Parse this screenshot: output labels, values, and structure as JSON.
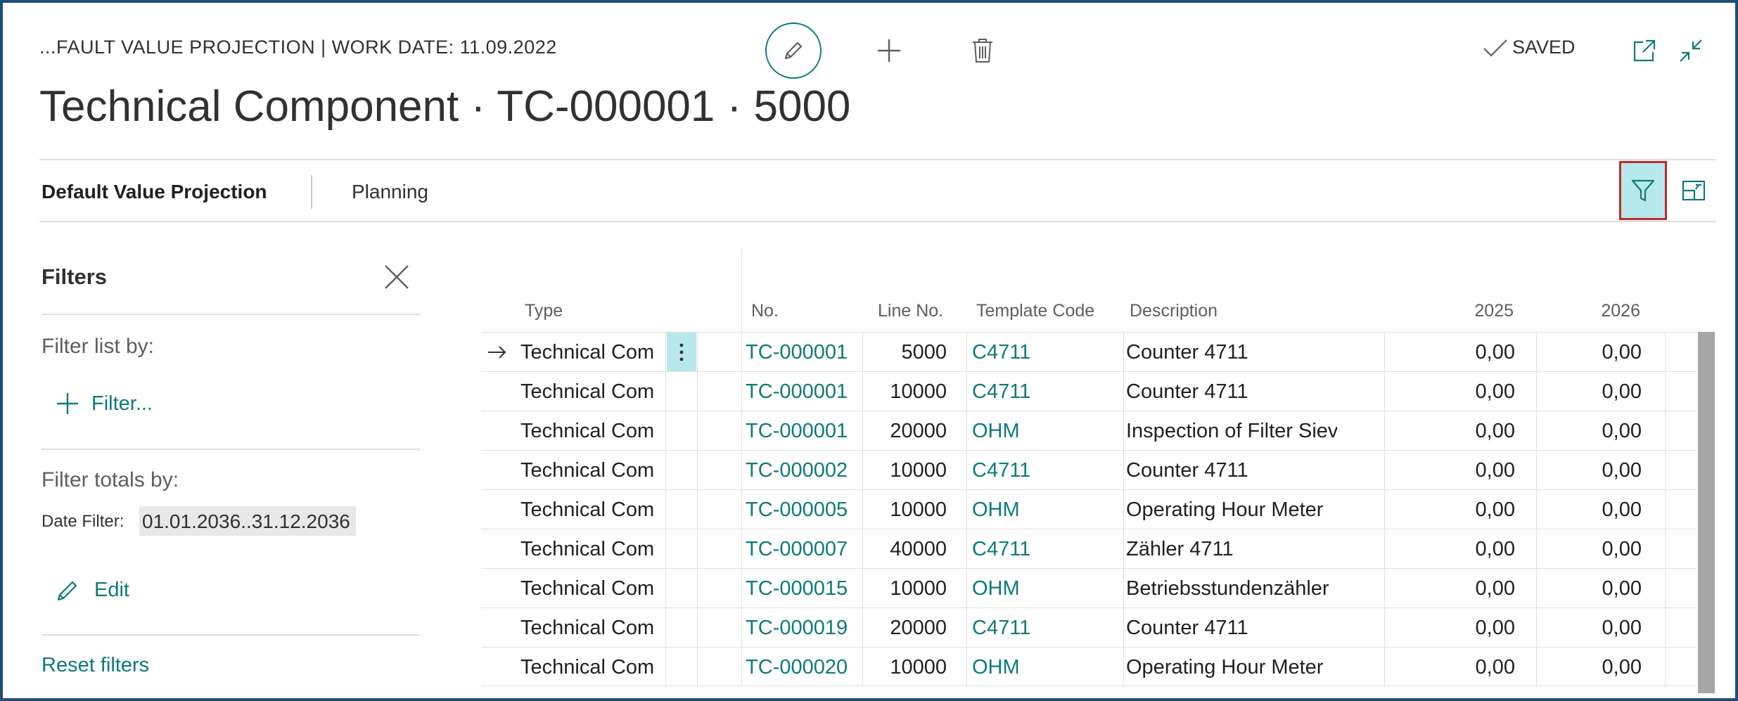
{
  "header": {
    "caption": "...FAULT VALUE PROJECTION | WORK DATE: 11.09.2022",
    "title": "Technical Component · TC-000001 · 5000",
    "saved_label": "SAVED",
    "icons": [
      "edit-icon",
      "plus-icon",
      "trash-icon",
      "checkmark-icon",
      "popout-icon",
      "collapse-icon"
    ]
  },
  "action_bar": {
    "tab_default": "Default Value Projection",
    "tab_planning": "Planning",
    "icons": [
      "filter-icon",
      "details-pane-icon"
    ]
  },
  "filter_pane": {
    "title": "Filters",
    "filter_list_by": "Filter list by:",
    "add_filter": "Filter...",
    "filter_totals_by": "Filter totals by:",
    "date_filter_label": "Date Filter:",
    "date_filter_value": "01.01.2036..31.12.2036",
    "edit_label": "Edit",
    "reset_label": "Reset filters"
  },
  "grid": {
    "columns": [
      "Type",
      "No.",
      "Line No.",
      "Template Code",
      "Description",
      "2025",
      "2026"
    ],
    "rows": [
      {
        "type": "Technical Comp...",
        "no": "TC-000001",
        "line_no": "5000",
        "template": "C4711",
        "description": "Counter 4711",
        "y2025": "0,00",
        "y2026": "0,00"
      },
      {
        "type": "Technical Comp...",
        "no": "TC-000001",
        "line_no": "10000",
        "template": "C4711",
        "description": "Counter 4711",
        "y2025": "0,00",
        "y2026": "0,00"
      },
      {
        "type": "Technical Comp...",
        "no": "TC-000001",
        "line_no": "20000",
        "template": "OHM",
        "description": "Inspection of Filter Sieve",
        "y2025": "0,00",
        "y2026": "0,00"
      },
      {
        "type": "Technical Comp...",
        "no": "TC-000002",
        "line_no": "10000",
        "template": "C4711",
        "description": "Counter 4711",
        "y2025": "0,00",
        "y2026": "0,00"
      },
      {
        "type": "Technical Comp...",
        "no": "TC-000005",
        "line_no": "10000",
        "template": "OHM",
        "description": "Operating Hour Meter",
        "y2025": "0,00",
        "y2026": "0,00"
      },
      {
        "type": "Technical Comp...",
        "no": "TC-000007",
        "line_no": "40000",
        "template": "C4711",
        "description": "Zähler 4711",
        "y2025": "0,00",
        "y2026": "0,00"
      },
      {
        "type": "Technical Comp...",
        "no": "TC-000015",
        "line_no": "10000",
        "template": "OHM",
        "description": "Betriebsstundenzähler",
        "y2025": "0,00",
        "y2026": "0,00"
      },
      {
        "type": "Technical Comp...",
        "no": "TC-000019",
        "line_no": "20000",
        "template": "C4711",
        "description": "Counter 4711",
        "y2025": "0,00",
        "y2026": "0,00"
      },
      {
        "type": "Technical Comp...",
        "no": "TC-000020",
        "line_no": "10000",
        "template": "OHM",
        "description": "Operating Hour Meter",
        "y2025": "0,00",
        "y2026": "0,00"
      }
    ],
    "selected_row": 0
  },
  "colors": {
    "link": "#0e7a7a",
    "accent_highlight": "#b7e8ec",
    "focus_border": "#c62828",
    "frame_border": "#1f4e79"
  }
}
